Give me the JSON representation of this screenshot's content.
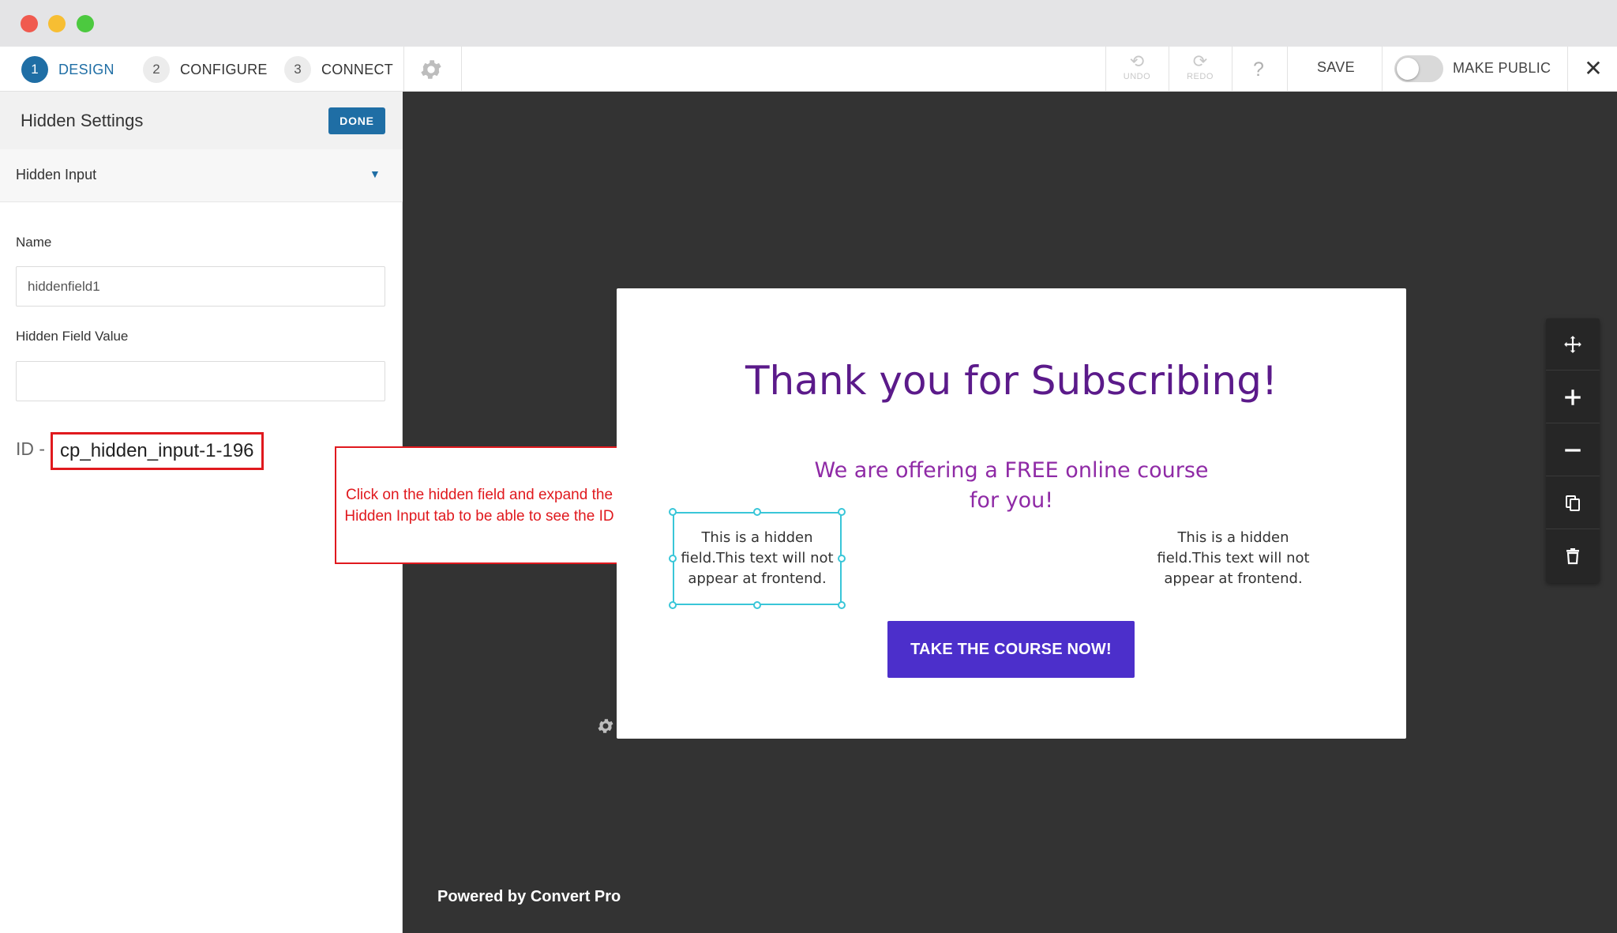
{
  "window": {
    "controls": [
      "close",
      "minimize",
      "maximize"
    ]
  },
  "toolbar": {
    "steps": [
      {
        "number": "1",
        "label": "DESIGN",
        "active": true
      },
      {
        "number": "2",
        "label": "CONFIGURE",
        "active": false
      },
      {
        "number": "3",
        "label": "CONNECT",
        "active": false
      }
    ],
    "settings_icon": "gear-icon",
    "undo_label": "UNDO",
    "redo_label": "REDO",
    "help_label": "?",
    "save_label": "SAVE",
    "make_public_label": "MAKE PUBLIC",
    "make_public_on": false,
    "close_label": "✕"
  },
  "panel": {
    "title": "Hidden Settings",
    "done_label": "DONE",
    "section_label": "Hidden Input",
    "name_label": "Name",
    "name_value": "hiddenfield1",
    "value_label": "Hidden Field Value",
    "value_value": "",
    "id_prefix": "ID -",
    "id_value": "cp_hidden_input-1-196"
  },
  "callout": {
    "text": "Click on the hidden field and expand the Hidden Input tab to be able to see the ID"
  },
  "modal": {
    "title": "Thank you for Subscribing!",
    "subtitle": "We are offering a FREE online course for you!",
    "hidden_text_left": "This is a hidden field.This text will not appear at frontend.",
    "hidden_text_right": "This is a hidden field.This text will not appear at frontend.",
    "cta_label": "TAKE THE COURSE NOW!"
  },
  "tools": [
    "move-icon",
    "zoom-in-icon",
    "zoom-out-icon",
    "duplicate-icon",
    "delete-icon"
  ],
  "footer": {
    "powered_by": "Powered by Convert Pro"
  },
  "colors": {
    "accent": "#1f6ea5",
    "title_purple": "#5b1a8a",
    "subtitle_purple": "#8f2aa6",
    "cta": "#4c2fcb",
    "annotation_red": "#e0191e",
    "selection_cyan": "#39c6d8",
    "canvas_bg": "#333333"
  }
}
